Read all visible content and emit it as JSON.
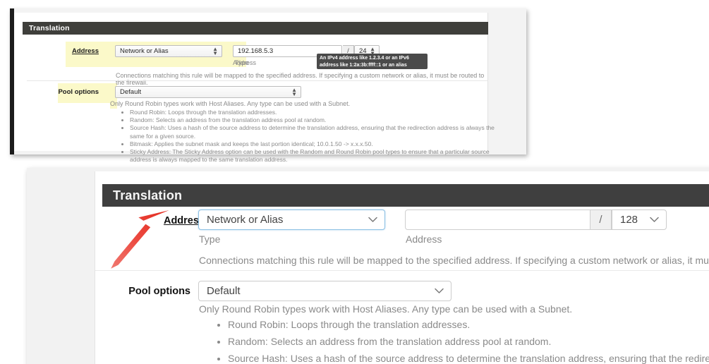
{
  "top_panel": {
    "section_title": "Translation",
    "address_label": "Address",
    "type_select_value": "Network or Alias",
    "type_sublabel": "Type",
    "address_input_value": "192.168.5.3",
    "slash": "/",
    "mask_select_value": "24",
    "address_sublabel": "Address",
    "tooltip_text": "An IPv4 address like 1.2.3.4 or an IPv6 address like 1:2a:3b:ffff::1 or an alias",
    "help_text_address": "Connections matching this rule will be mapped to the specified address. If specifying a custom network or alias, it must be routed to the firewall.",
    "pool_options_label": "Pool options",
    "pool_select_value": "Default",
    "help_text_pool": "Only Round Robin types work with Host Aliases. Any type can be used with a Subnet.",
    "pool_bullets": [
      "Round Robin: Loops through the translation addresses.",
      "Random: Selects an address from the translation address pool at random.",
      "Source Hash: Uses a hash of the source address to determine the translation address, ensuring that the redirection address is always the same for a given source.",
      "Bitmask: Applies the subnet mask and keeps the last portion identical; 10.0.1.50 -> x.x.x.50.",
      "Sticky Address: The Sticky Address option can be used with the Random and Round Robin pool types to ensure that a particular source address is always mapped to the same translation address."
    ]
  },
  "bottom_panel": {
    "section_title": "Translation",
    "address_label": "Address",
    "type_select_value": "Network or Alias",
    "type_sublabel": "Type",
    "address_input_value": "",
    "address_input_placeholder": "",
    "slash": "/",
    "mask_select_value": "128",
    "address_sublabel": "Address",
    "help_text_address": "Connections matching this rule will be mapped to the specified address. If specifying a custom network or alias, it must b",
    "pool_options_label": "Pool options",
    "pool_select_value": "Default",
    "help_text_pool": "Only Round Robin types work with Host Aliases. Any type can be used with a Subnet.",
    "pool_bullets": [
      "Round Robin: Loops through the translation addresses.",
      "Random: Selects an address from the translation address pool at random.",
      "Source Hash: Uses a hash of the source address to determine the translation address, ensuring that the redirection"
    ]
  },
  "annotation": {
    "arrow_name": "red-arrow-pointing-to-type-dropdown",
    "arrow_color": "#e8342a"
  },
  "colors": {
    "header_bar": "#3f3f3f",
    "highlight_yellow": "#fbf9c9",
    "focus_blue": "#8cc0e4",
    "muted_text": "#8a8a8a"
  },
  "icons": {
    "chevron_down": "⌄",
    "spinner_updown": "↕"
  }
}
